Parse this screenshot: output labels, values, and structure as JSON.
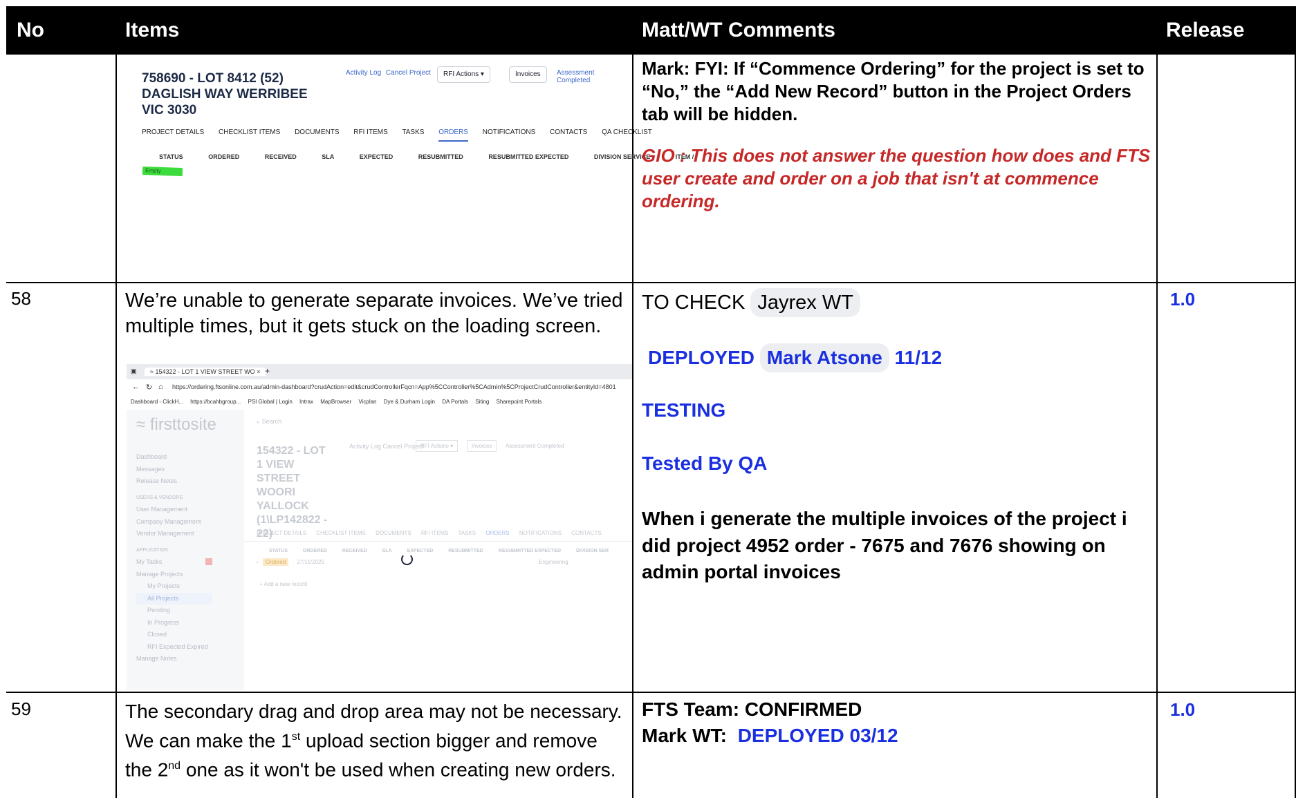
{
  "table": {
    "headers": [
      "No",
      "Items",
      "Matt/WT Comments",
      "Release"
    ]
  },
  "row_prev": {
    "screenshot": {
      "title": "758690 - LOT 8412 (52) DAGLISH WAY WERRIBEE VIC 3030",
      "links": [
        "Activity Log",
        "Cancel Project"
      ],
      "rfi_button": "RFI Actions",
      "invoices_button": "Invoices",
      "status_text": "Assessment Completed",
      "tabs": [
        "PROJECT DETAILS",
        "CHECKLIST ITEMS",
        "DOCUMENTS",
        "RFI ITEMS",
        "TASKS",
        "ORDERS",
        "NOTIFICATIONS",
        "CONTACTS",
        "QA CHECKLIST"
      ],
      "columns": [
        "STATUS",
        "ORDERED",
        "RECEIVED",
        "SLA",
        "EXPECTED",
        "RESUBMITTED",
        "RESUBMITTED EXPECTED",
        "DIVISION SERVICE",
        "ITEM /"
      ],
      "empty_badge": "Empty"
    },
    "comment_mark": "Mark: FYI: If “Commence Ordering” for the project is set to “No,” the “Add New Record” button in the Project Orders tab will be hidden.",
    "comment_gio": "GIO : This does not answer the question how does and FTS user create and order on a job that isn't at commence ordering."
  },
  "row58": {
    "no": "58",
    "item_text": "We’re unable to generate separate invoices. We’ve tried multiple times, but it gets stuck on the loading screen.",
    "screenshot": {
      "tab_title": "154322 - LOT 1 VIEW STREET WO",
      "url": "https://ordering.ftsonline.com.au/admin-dashboard?crudAction=edit&crudControllerFqcn=App%5CController%5CAdmin%5CProjectCrudController&entityId=4801",
      "bookmarks": [
        "Dashboard - ClickH...",
        "https://bcahbgroup...",
        "PSI Global | Login",
        "Intrax",
        "MapBrowser",
        "Vicplan",
        "Dye & Durham Login",
        "DA Portals",
        "Siting",
        "Sharepoint Portals"
      ],
      "logo": "firsttosite",
      "search": "Search",
      "sidebar": [
        "Dashboard",
        "Messages",
        "Release Notes",
        "USERS & VENDORS",
        "User Management",
        "Company Management",
        "Vendor Management",
        "APPLICATION",
        "My Tasks",
        "Manage Projects",
        "My Projects",
        "All Projects",
        "Pending",
        "In Progress",
        "Closed",
        "RFI Expected Expired",
        "Manage Notes"
      ],
      "title": "154322 - LOT 1 VIEW STREET WOORI YALLOCK (1\\LP142822 - 22)",
      "links": [
        "Activity Log",
        "Cancel Project"
      ],
      "rfi_button": "RFI Actions",
      "invoices_button": "Invoices",
      "status_text": "Assessment Completed",
      "tabs": [
        "PROJECT DETAILS",
        "CHECKLIST ITEMS",
        "DOCUMENTS",
        "RFI ITEMS",
        "TASKS",
        "ORDERS",
        "NOTIFICATIONS",
        "CONTACTS"
      ],
      "columns": [
        "STATUS",
        "ORDERED",
        "RECEIVED",
        "SLA",
        "EXPECTED",
        "RESUBMITTED",
        "RESUBMITTED EXPECTED",
        "DIVISION SER"
      ],
      "row_status": "Ordered",
      "row_date": "27/11/2025",
      "row_service": "Engineering",
      "add_record": "+ Add a new record"
    },
    "comment_to_check": "TO CHECK",
    "comment_to_check_chip": "Jayrex WT",
    "comment_deployed": "DEPLOYED",
    "comment_deployed_chip": "Mark Atsone",
    "comment_deployed_date": "11/12",
    "comment_testing": "TESTING",
    "comment_tested": "Tested By QA",
    "comment_detail": "When i generate the multiple invoices of the project i did project 4952 order - 7675 and 7676 showing on admin portal invoices",
    "release": "1.0"
  },
  "row59": {
    "no": "59",
    "item_text_a": "The secondary drag and drop area may not be necessary. We can make the 1",
    "item_sup_1": "st",
    "item_text_b": " upload section bigger and remove the 2",
    "item_sup_2": "nd",
    "item_text_c": " one as it won't be used when creating new orders.",
    "comment_fts": "FTS Team: CONFIRMED",
    "comment_mark_prefix": "Mark WT:",
    "comment_deployed": "DEPLOYED 03/12",
    "release": "1.0"
  }
}
